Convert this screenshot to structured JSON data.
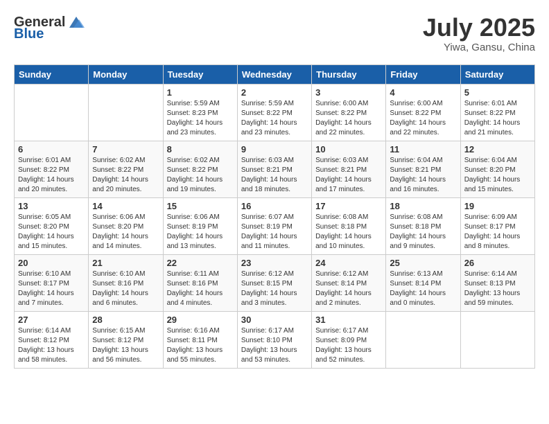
{
  "header": {
    "logo_general": "General",
    "logo_blue": "Blue",
    "month_title": "July 2025",
    "location": "Yiwa, Gansu, China"
  },
  "calendar": {
    "days_of_week": [
      "Sunday",
      "Monday",
      "Tuesday",
      "Wednesday",
      "Thursday",
      "Friday",
      "Saturday"
    ],
    "weeks": [
      [
        {
          "day": "",
          "info": ""
        },
        {
          "day": "",
          "info": ""
        },
        {
          "day": "1",
          "info": "Sunrise: 5:59 AM\nSunset: 8:23 PM\nDaylight: 14 hours and 23 minutes."
        },
        {
          "day": "2",
          "info": "Sunrise: 5:59 AM\nSunset: 8:22 PM\nDaylight: 14 hours and 23 minutes."
        },
        {
          "day": "3",
          "info": "Sunrise: 6:00 AM\nSunset: 8:22 PM\nDaylight: 14 hours and 22 minutes."
        },
        {
          "day": "4",
          "info": "Sunrise: 6:00 AM\nSunset: 8:22 PM\nDaylight: 14 hours and 22 minutes."
        },
        {
          "day": "5",
          "info": "Sunrise: 6:01 AM\nSunset: 8:22 PM\nDaylight: 14 hours and 21 minutes."
        }
      ],
      [
        {
          "day": "6",
          "info": "Sunrise: 6:01 AM\nSunset: 8:22 PM\nDaylight: 14 hours and 20 minutes."
        },
        {
          "day": "7",
          "info": "Sunrise: 6:02 AM\nSunset: 8:22 PM\nDaylight: 14 hours and 20 minutes."
        },
        {
          "day": "8",
          "info": "Sunrise: 6:02 AM\nSunset: 8:22 PM\nDaylight: 14 hours and 19 minutes."
        },
        {
          "day": "9",
          "info": "Sunrise: 6:03 AM\nSunset: 8:21 PM\nDaylight: 14 hours and 18 minutes."
        },
        {
          "day": "10",
          "info": "Sunrise: 6:03 AM\nSunset: 8:21 PM\nDaylight: 14 hours and 17 minutes."
        },
        {
          "day": "11",
          "info": "Sunrise: 6:04 AM\nSunset: 8:21 PM\nDaylight: 14 hours and 16 minutes."
        },
        {
          "day": "12",
          "info": "Sunrise: 6:04 AM\nSunset: 8:20 PM\nDaylight: 14 hours and 15 minutes."
        }
      ],
      [
        {
          "day": "13",
          "info": "Sunrise: 6:05 AM\nSunset: 8:20 PM\nDaylight: 14 hours and 15 minutes."
        },
        {
          "day": "14",
          "info": "Sunrise: 6:06 AM\nSunset: 8:20 PM\nDaylight: 14 hours and 14 minutes."
        },
        {
          "day": "15",
          "info": "Sunrise: 6:06 AM\nSunset: 8:19 PM\nDaylight: 14 hours and 13 minutes."
        },
        {
          "day": "16",
          "info": "Sunrise: 6:07 AM\nSunset: 8:19 PM\nDaylight: 14 hours and 11 minutes."
        },
        {
          "day": "17",
          "info": "Sunrise: 6:08 AM\nSunset: 8:18 PM\nDaylight: 14 hours and 10 minutes."
        },
        {
          "day": "18",
          "info": "Sunrise: 6:08 AM\nSunset: 8:18 PM\nDaylight: 14 hours and 9 minutes."
        },
        {
          "day": "19",
          "info": "Sunrise: 6:09 AM\nSunset: 8:17 PM\nDaylight: 14 hours and 8 minutes."
        }
      ],
      [
        {
          "day": "20",
          "info": "Sunrise: 6:10 AM\nSunset: 8:17 PM\nDaylight: 14 hours and 7 minutes."
        },
        {
          "day": "21",
          "info": "Sunrise: 6:10 AM\nSunset: 8:16 PM\nDaylight: 14 hours and 6 minutes."
        },
        {
          "day": "22",
          "info": "Sunrise: 6:11 AM\nSunset: 8:16 PM\nDaylight: 14 hours and 4 minutes."
        },
        {
          "day": "23",
          "info": "Sunrise: 6:12 AM\nSunset: 8:15 PM\nDaylight: 14 hours and 3 minutes."
        },
        {
          "day": "24",
          "info": "Sunrise: 6:12 AM\nSunset: 8:14 PM\nDaylight: 14 hours and 2 minutes."
        },
        {
          "day": "25",
          "info": "Sunrise: 6:13 AM\nSunset: 8:14 PM\nDaylight: 14 hours and 0 minutes."
        },
        {
          "day": "26",
          "info": "Sunrise: 6:14 AM\nSunset: 8:13 PM\nDaylight: 13 hours and 59 minutes."
        }
      ],
      [
        {
          "day": "27",
          "info": "Sunrise: 6:14 AM\nSunset: 8:12 PM\nDaylight: 13 hours and 58 minutes."
        },
        {
          "day": "28",
          "info": "Sunrise: 6:15 AM\nSunset: 8:12 PM\nDaylight: 13 hours and 56 minutes."
        },
        {
          "day": "29",
          "info": "Sunrise: 6:16 AM\nSunset: 8:11 PM\nDaylight: 13 hours and 55 minutes."
        },
        {
          "day": "30",
          "info": "Sunrise: 6:17 AM\nSunset: 8:10 PM\nDaylight: 13 hours and 53 minutes."
        },
        {
          "day": "31",
          "info": "Sunrise: 6:17 AM\nSunset: 8:09 PM\nDaylight: 13 hours and 52 minutes."
        },
        {
          "day": "",
          "info": ""
        },
        {
          "day": "",
          "info": ""
        }
      ]
    ]
  }
}
